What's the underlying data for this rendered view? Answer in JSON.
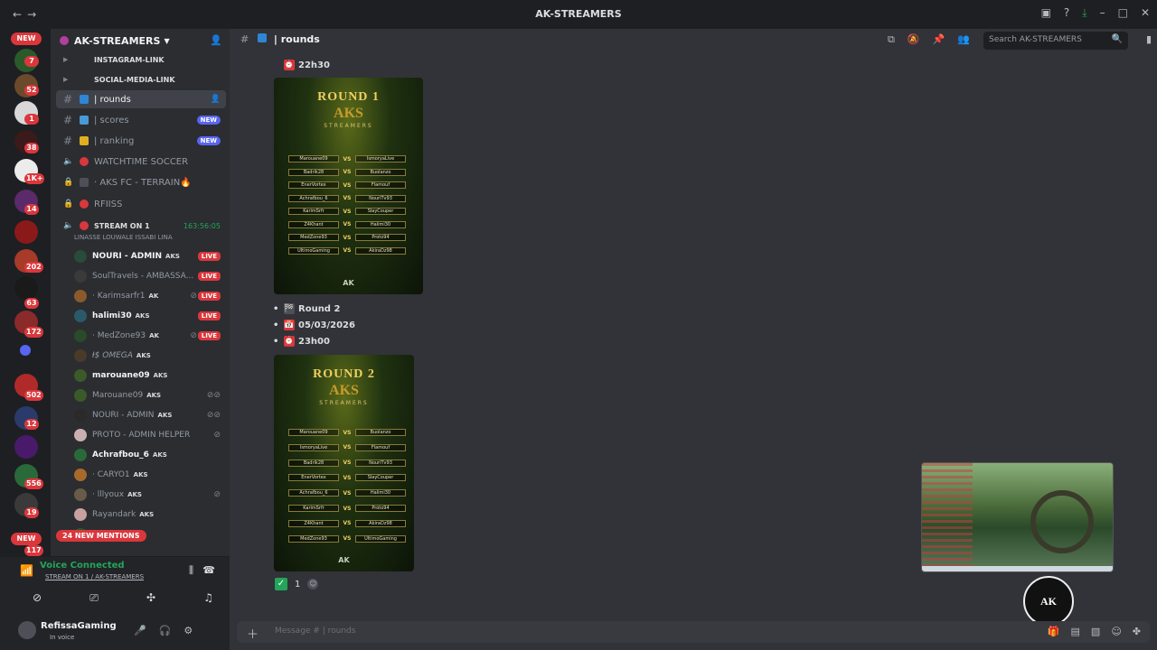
{
  "window": {
    "title": "AK-STREAMERS"
  },
  "server": {
    "name": "AK-STREAMERS",
    "badges": [
      "NEW",
      "7",
      "52",
      "1",
      "38",
      "1K+",
      "14",
      "202",
      "63",
      "172",
      "502",
      "12",
      "556",
      "19",
      "117",
      "NEW"
    ]
  },
  "channels": {
    "items": [
      {
        "label": "INSTAGRAM-LINK",
        "emoji_color": "#8e6ad8"
      },
      {
        "label": "SOCIAL-MEDIA-LINK",
        "emoji_color": "#949ba4"
      },
      {
        "label": "| rounds",
        "emoji_color": "#2f86d6"
      },
      {
        "label": "| scores",
        "emoji_color": "#4a9ad6",
        "badge": "NEW"
      },
      {
        "label": "| ranking",
        "emoji_color": "#e0b020",
        "badge": "NEW"
      },
      {
        "label": "WATCHTIME SOCCER",
        "emoji_color": "#da373c"
      },
      {
        "label": "· AKS FC - TERRAIN🔥",
        "emoji_color": "#4e5058"
      },
      {
        "label": "RFIISS",
        "emoji_color": "#da373c"
      }
    ],
    "voice_channel": {
      "label": "STREAM ON 1",
      "timer": "163:56:05",
      "status": "LINASSE LOUWALE ISSABI LINA"
    },
    "users": [
      {
        "name": "NOURI - ADMIN",
        "tag": "AKS",
        "live": "LIVE",
        "bright": true
      },
      {
        "name": "SoulTravels - AMBASSA...",
        "tag": "",
        "live": "LIVE",
        "bright": false
      },
      {
        "name": "· Karimsarfr1",
        "tag": "AK",
        "live": "LIVE",
        "bright": false
      },
      {
        "name": "halimi30",
        "tag": "AKS",
        "live": "LIVE",
        "bright": true
      },
      {
        "name": "· MedZone93",
        "tag": "AK",
        "live": "LIVE",
        "bright": false
      },
      {
        "name": "Ɨ$ OMEGA",
        "tag": "AKS",
        "live": "",
        "bright": false
      },
      {
        "name": "marouane09",
        "tag": "AKS",
        "live": "",
        "bright": true
      },
      {
        "name": "Marouane09",
        "tag": "AKS",
        "live": "",
        "bright": false
      },
      {
        "name": "NOURI - ADMIN",
        "tag": "AKS",
        "live": "",
        "bright": false
      },
      {
        "name": "PROTO - ADMIN HELPER",
        "tag": "",
        "live": "",
        "bright": false
      },
      {
        "name": "Achrafbou_6",
        "tag": "AKS",
        "live": "",
        "bright": true
      },
      {
        "name": "· CARYO1",
        "tag": "AKS",
        "live": "",
        "bright": false
      },
      {
        "name": "· lllyoux",
        "tag": "AKS",
        "live": "",
        "bright": false
      },
      {
        "name": "Rayandark",
        "tag": "AKS",
        "live": "",
        "bright": false
      }
    ],
    "mentions": "24 NEW MENTIONS"
  },
  "voice": {
    "status": "Voice Connected",
    "channel": "STREAM ON 1 / AK-STREAMERS"
  },
  "userbar": {
    "name": "RefissaGaming",
    "status": "In voice"
  },
  "header": {
    "channel": "| rounds",
    "search_placeholder": "Search AK-STREAMERS"
  },
  "messages": {
    "r1_time": "22h30",
    "r2_title": "Round 2",
    "r2_date": "05/03/2026",
    "r2_time": "23h00",
    "reaction_count": "1"
  },
  "posters": {
    "r1": {
      "title": "ROUND 1",
      "logo": "AKS",
      "sub": "STREAMERS",
      "footer": "AK",
      "matches": [
        [
          "Marouane09",
          "IsmoryaLive"
        ],
        [
          "Badrik28",
          "Buolanzo"
        ],
        [
          "EnerVortex",
          "Flamouf"
        ],
        [
          "Achrafbou_6",
          "NouriTv93"
        ],
        [
          "KarimSrfr",
          "SlayCouper"
        ],
        [
          "Z4Khant",
          "Halimi30"
        ],
        [
          "MedZone93",
          "Proto94"
        ],
        [
          "UltimoGaming",
          "AkiraDz98"
        ]
      ]
    },
    "r2": {
      "title": "ROUND 2",
      "logo": "AKS",
      "sub": "STREAMERS",
      "footer": "AK",
      "matches": [
        [
          "Marouane09",
          "Buolanzo"
        ],
        [
          "IsmoryaLive",
          "Flamouf"
        ],
        [
          "Badrik28",
          "NouriTv93"
        ],
        [
          "EnerVortex",
          "SlayCouper"
        ],
        [
          "Achrafbou_6",
          "Halimi30"
        ],
        [
          "KarimSrfr",
          "Proto94"
        ],
        [
          "Z4Khant",
          "AkiraDz98"
        ],
        [
          "MedZone93",
          "UltimoGaming"
        ]
      ]
    }
  },
  "composer": {
    "placeholder": "Message #  | rounds"
  },
  "watermark": {
    "text": "AK"
  },
  "colors": {
    "accent": "#5865f2",
    "live": "#da373c",
    "online": "#23a55a"
  },
  "icons": [
    "back-icon",
    "forward-icon",
    "inbox-icon",
    "help-icon",
    "download-icon",
    "minimize-icon",
    "maximize-icon",
    "close-icon",
    "hash-icon",
    "threads-icon",
    "mute-icon",
    "pin-icon",
    "members-icon",
    "search-icon",
    "add-member-icon",
    "mic-icon",
    "headphones-icon",
    "settings-icon",
    "gift-icon",
    "gif-icon",
    "sticker-icon",
    "emoji-icon",
    "apps-icon"
  ]
}
